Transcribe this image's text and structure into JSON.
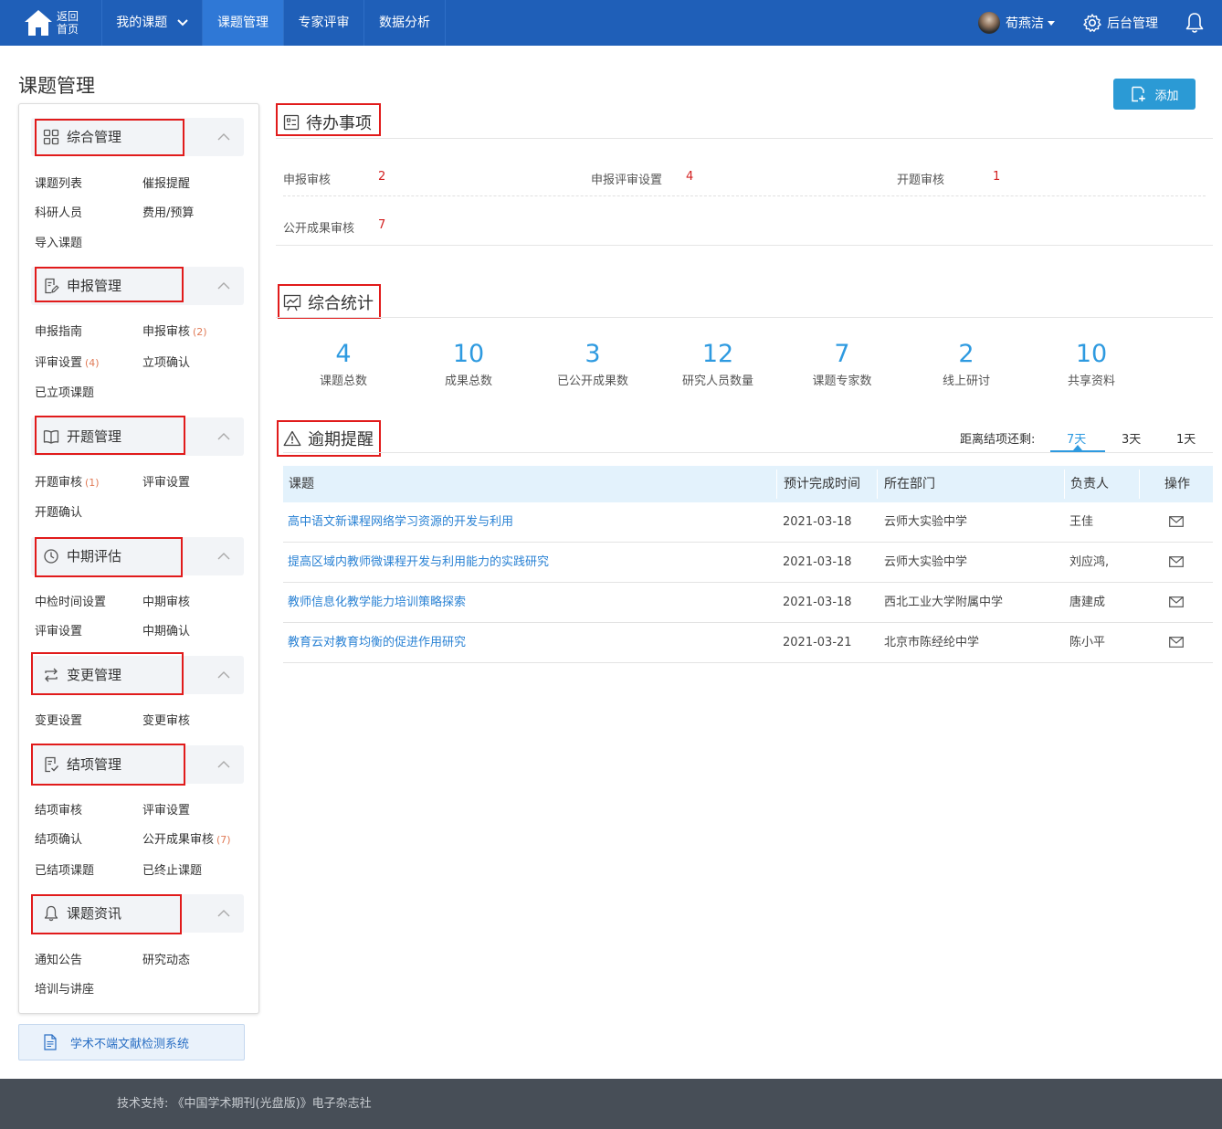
{
  "header": {
    "home_label_line1": "返回",
    "home_label_line2": "首页",
    "nav": [
      {
        "label": "我的课题"
      },
      {
        "label": "课题管理"
      },
      {
        "label": "专家评审"
      },
      {
        "label": "数据分析"
      }
    ],
    "user_name": "荀燕洁",
    "admin_label": "后台管理"
  },
  "page_title": "课题管理",
  "add_button": "添加",
  "sidebar": {
    "sections": [
      {
        "title": "综合管理",
        "icon": "grid-icon",
        "links": [
          {
            "label": "课题列表"
          },
          {
            "label": "催报提醒"
          },
          {
            "label": "科研人员"
          },
          {
            "label": "费用/预算"
          },
          {
            "label": "导入课题"
          }
        ]
      },
      {
        "title": "申报管理",
        "icon": "edit-doc-icon",
        "links": [
          {
            "label": "申报指南"
          },
          {
            "label": "申报审核",
            "count": "(2)"
          },
          {
            "label": "评审设置",
            "count": "(4)"
          },
          {
            "label": "立项确认"
          },
          {
            "label": "已立项课题"
          }
        ]
      },
      {
        "title": "开题管理",
        "icon": "book-icon",
        "links": [
          {
            "label": "开题审核",
            "count": "(1)"
          },
          {
            "label": "评审设置"
          },
          {
            "label": "开题确认"
          }
        ]
      },
      {
        "title": "中期评估",
        "icon": "clock-icon",
        "links": [
          {
            "label": "中检时间设置"
          },
          {
            "label": "中期审核"
          },
          {
            "label": "评审设置"
          },
          {
            "label": "中期确认"
          }
        ]
      },
      {
        "title": "变更管理",
        "icon": "swap-icon",
        "links": [
          {
            "label": "变更设置"
          },
          {
            "label": "变更审核"
          }
        ]
      },
      {
        "title": "结项管理",
        "icon": "check-doc-icon",
        "links": [
          {
            "label": "结项审核"
          },
          {
            "label": "评审设置"
          },
          {
            "label": "结项确认"
          },
          {
            "label": "公开成果审核",
            "count": "(7)"
          },
          {
            "label": "已结项课题"
          },
          {
            "label": "已终止课题"
          }
        ]
      },
      {
        "title": "课题资讯",
        "icon": "bell-icon",
        "links": [
          {
            "label": "通知公告"
          },
          {
            "label": "研究动态"
          },
          {
            "label": "培训与讲座"
          }
        ]
      }
    ],
    "bottom_button": "学术不端文献检测系统"
  },
  "todo": {
    "title": "待办事项",
    "items": [
      {
        "label": "申报审核",
        "value": "2"
      },
      {
        "label": "申报评审设置",
        "value": "4"
      },
      {
        "label": "开题审核",
        "value": "1"
      },
      {
        "label": "公开成果审核",
        "value": "7"
      }
    ]
  },
  "stats": {
    "title": "综合统计",
    "items": [
      {
        "value": "4",
        "label": "课题总数"
      },
      {
        "value": "10",
        "label": "成果总数"
      },
      {
        "value": "3",
        "label": "已公开成果数"
      },
      {
        "value": "12",
        "label": "研究人员数量"
      },
      {
        "value": "7",
        "label": "课题专家数"
      },
      {
        "value": "2",
        "label": "线上研讨"
      },
      {
        "value": "10",
        "label": "共享资料"
      }
    ]
  },
  "overdue": {
    "title": "逾期提醒",
    "filter_label": "距离结项还剩:",
    "tabs": [
      {
        "label": "7天"
      },
      {
        "label": "3天"
      },
      {
        "label": "1天"
      }
    ],
    "active_tab": 0,
    "columns": [
      "课题",
      "预计完成时间",
      "所在部门",
      "负责人",
      "操作"
    ],
    "rows": [
      {
        "title": "高中语文新课程网络学习资源的开发与利用",
        "date": "2021-03-18",
        "dept": "云师大实验中学",
        "owner": "王佳"
      },
      {
        "title": "提高区域内教师微课程开发与利用能力的实践研究",
        "date": "2021-03-18",
        "dept": "云师大实验中学",
        "owner": "刘应鸿,"
      },
      {
        "title": "教师信息化教学能力培训策略探索",
        "date": "2021-03-18",
        "dept": "西北工业大学附属中学",
        "owner": "唐建成"
      },
      {
        "title": "教育云对教育均衡的促进作用研究",
        "date": "2021-03-21",
        "dept": "北京市陈经纶中学",
        "owner": "陈小平"
      }
    ]
  },
  "footer": "技术支持: 《中国学术期刊(光盘版)》电子杂志社",
  "colors": {
    "topbar": "#1f5fb8",
    "accent": "#2e9ae0",
    "highlight": "#e11b1b"
  }
}
